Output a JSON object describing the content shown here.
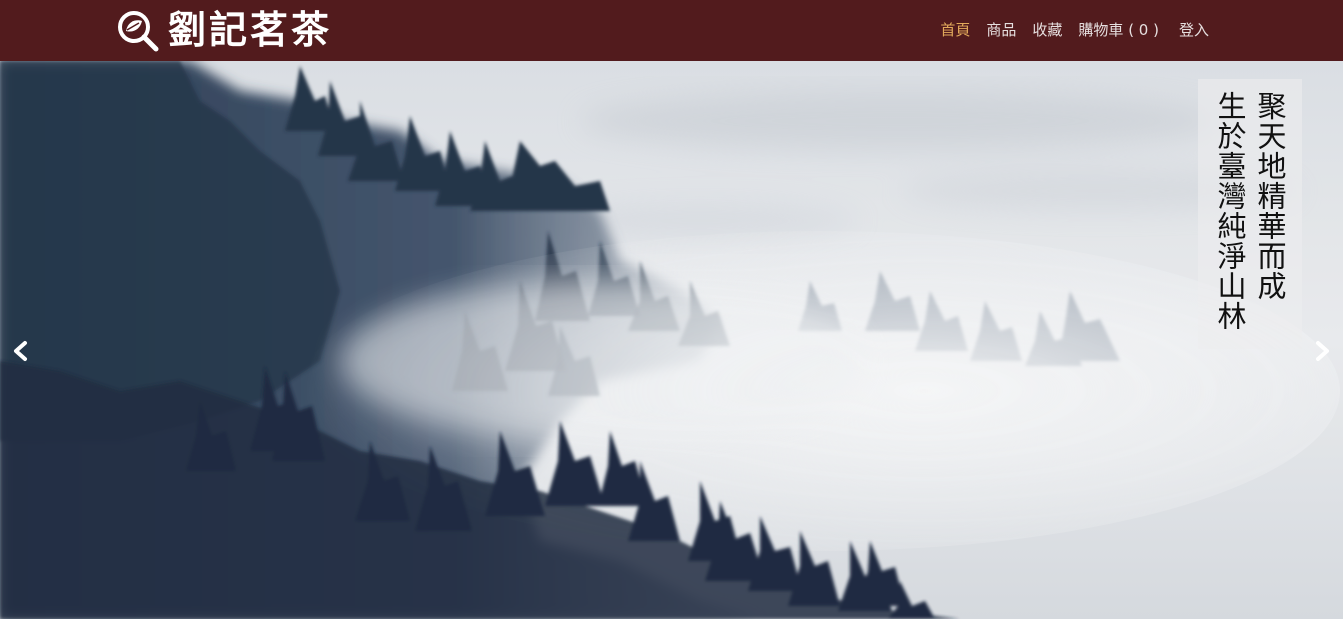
{
  "brand": {
    "logo_icon": "search-leaf-icon",
    "name": "劉記茗茶"
  },
  "nav": {
    "items": [
      {
        "label": "首頁",
        "active": true
      },
      {
        "label": "商品",
        "active": false
      },
      {
        "label": "收藏",
        "active": false
      },
      {
        "label": "購物車 ( 0 )",
        "active": false
      },
      {
        "label": "登入",
        "active": false
      }
    ]
  },
  "hero": {
    "caption_line_1": "聚天地精華而成",
    "caption_line_2": "生於臺灣純淨山林",
    "prev_icon": "chevron-left-icon",
    "next_icon": "chevron-right-icon"
  },
  "colors": {
    "navbar_bg": "#521b1d",
    "nav_active": "#e2a95b",
    "nav_text": "#e6dfdf"
  }
}
